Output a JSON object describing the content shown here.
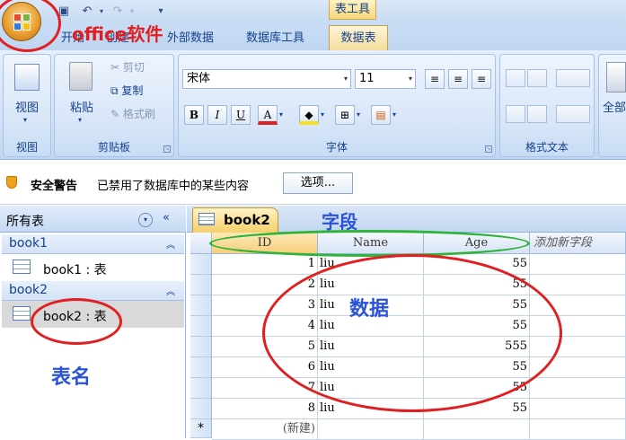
{
  "window": {
    "context_tab_title": "表工具",
    "tabs": [
      "开始",
      "创建",
      "外部数据",
      "数据库工具",
      "数据表"
    ]
  },
  "ribbon": {
    "groups": {
      "views": {
        "label": "视图",
        "button": "视图"
      },
      "clipboard": {
        "label": "剪贴板",
        "paste": "粘贴",
        "cut": "剪切",
        "copy": "复制",
        "format_painter": "格式刷"
      },
      "font": {
        "label": "字体",
        "font_name": "宋体",
        "font_size": "11"
      },
      "rich_text": {
        "label": "格式文本"
      },
      "records": {
        "button": "全部"
      }
    }
  },
  "security_bar": {
    "title": "安全警告",
    "message": "已禁用了数据库中的某些内容",
    "options_button": "选项..."
  },
  "nav_pane": {
    "title": "所有表",
    "groups": [
      {
        "name": "book1",
        "items": [
          {
            "label": "book1 : 表"
          }
        ]
      },
      {
        "name": "book2",
        "items": [
          {
            "label": "book2 : 表"
          }
        ]
      }
    ]
  },
  "document": {
    "tab_label": "book2",
    "columns": [
      "ID",
      "Name",
      "Age",
      "添加新字段"
    ],
    "rows": [
      {
        "id": "1",
        "name": "liu",
        "age": "55"
      },
      {
        "id": "2",
        "name": "liu",
        "age": "55"
      },
      {
        "id": "3",
        "name": "liu",
        "age": "55"
      },
      {
        "id": "4",
        "name": "liu",
        "age": "55"
      },
      {
        "id": "5",
        "name": "liu",
        "age": "555"
      },
      {
        "id": "6",
        "name": "liu",
        "age": "55"
      },
      {
        "id": "7",
        "name": "liu",
        "age": "55"
      },
      {
        "id": "8",
        "name": "liu",
        "age": "55"
      }
    ],
    "new_row_marker": "*",
    "new_row_label": "(新建)"
  },
  "annotations": {
    "office": "office软件",
    "field": "字段",
    "data": "数据",
    "table_name": "表名"
  },
  "colors": {
    "annotation_ellipse": "#e02020",
    "field_ellipse": "#2fb43a",
    "annotation_text": "#2a52d8"
  }
}
